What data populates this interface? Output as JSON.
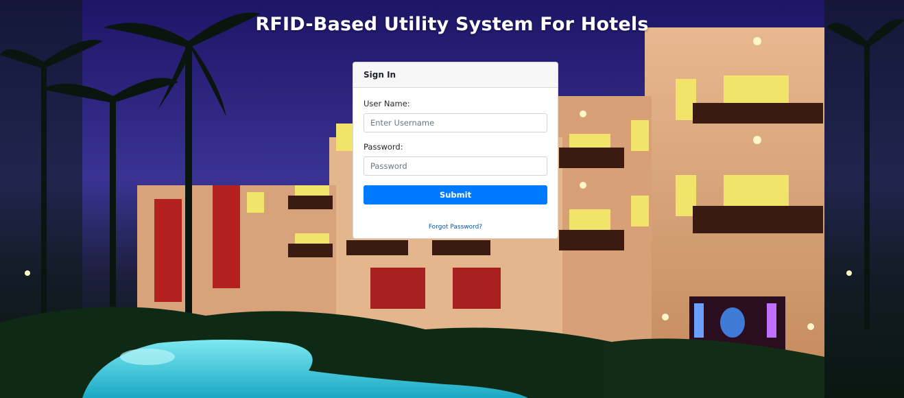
{
  "page": {
    "title": "RFID-Based Utility System For Hotels"
  },
  "signin": {
    "header": "Sign In",
    "username_label": "User Name:",
    "username_placeholder": "Enter Username",
    "username_value": "",
    "password_label": "Password:",
    "password_placeholder": "Password",
    "password_value": "",
    "submit_label": "Submit",
    "forgot_label": "Forgot Password?"
  },
  "colors": {
    "primary": "#007bff",
    "link": "#0056b3",
    "sky": "#2b2280"
  }
}
